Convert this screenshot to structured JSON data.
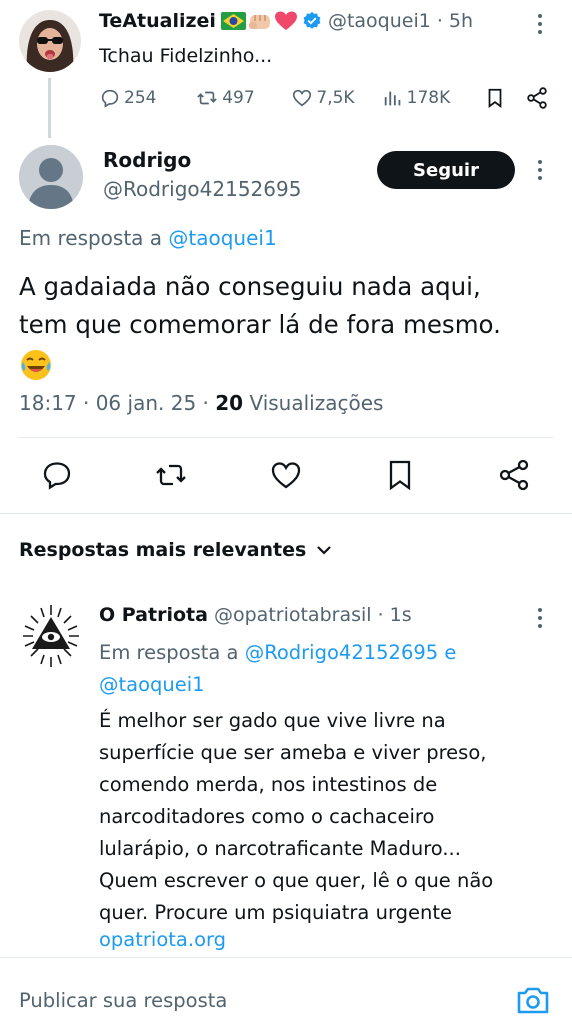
{
  "parent_tweet": {
    "name": "TeAtualizei",
    "emojis": [
      "flag-brazil",
      "fist",
      "heart"
    ],
    "handle": "@taoquei1",
    "time": "· 5h",
    "text": "Tchau Fidelzinho...",
    "replies": "254",
    "reposts": "497",
    "likes": "7,5K",
    "views": "178K"
  },
  "main_tweet": {
    "name": "Rodrigo",
    "handle": "@Rodrigo42152695",
    "follow_label": "Seguir",
    "reply_prefix": "Em resposta a",
    "reply_handle": "@taoquei1",
    "text_line1": "A gadaiada não conseguiu nada aqui,",
    "text_line2": "tem que comemorar lá de fora mesmo.",
    "timestamp": "18:17 · 06 jan. 25 ·",
    "views_count": "20",
    "views_label": "Visualizações"
  },
  "sort": {
    "label": "Respostas mais relevantes"
  },
  "reply": {
    "name": "O Patriota",
    "handle": "@opatriotabrasil",
    "time": "· 1s",
    "reply_prefix": "Em resposta a",
    "reply_handle1": "@Rodrigo42152695",
    "reply_and": "e",
    "reply_handle2": "@taoquei1",
    "lines": [
      "É melhor ser gado que vive livre na",
      "superfície que ser ameba e viver preso,",
      "comendo merda, nos intestinos de",
      "narcoditadores como o cachaceiro",
      "lularápio, o narcotraficante Maduro...",
      "Quem escrever o que quer, lê o que não",
      "quer. Procure um psiquiatra urgente"
    ],
    "link": "opatriota.org"
  },
  "composer": {
    "placeholder": "Publicar sua resposta"
  },
  "colors": {
    "text": "#0f1419",
    "muted": "#536471",
    "link": "#1d9bf0",
    "button_bg": "#0f1419"
  }
}
